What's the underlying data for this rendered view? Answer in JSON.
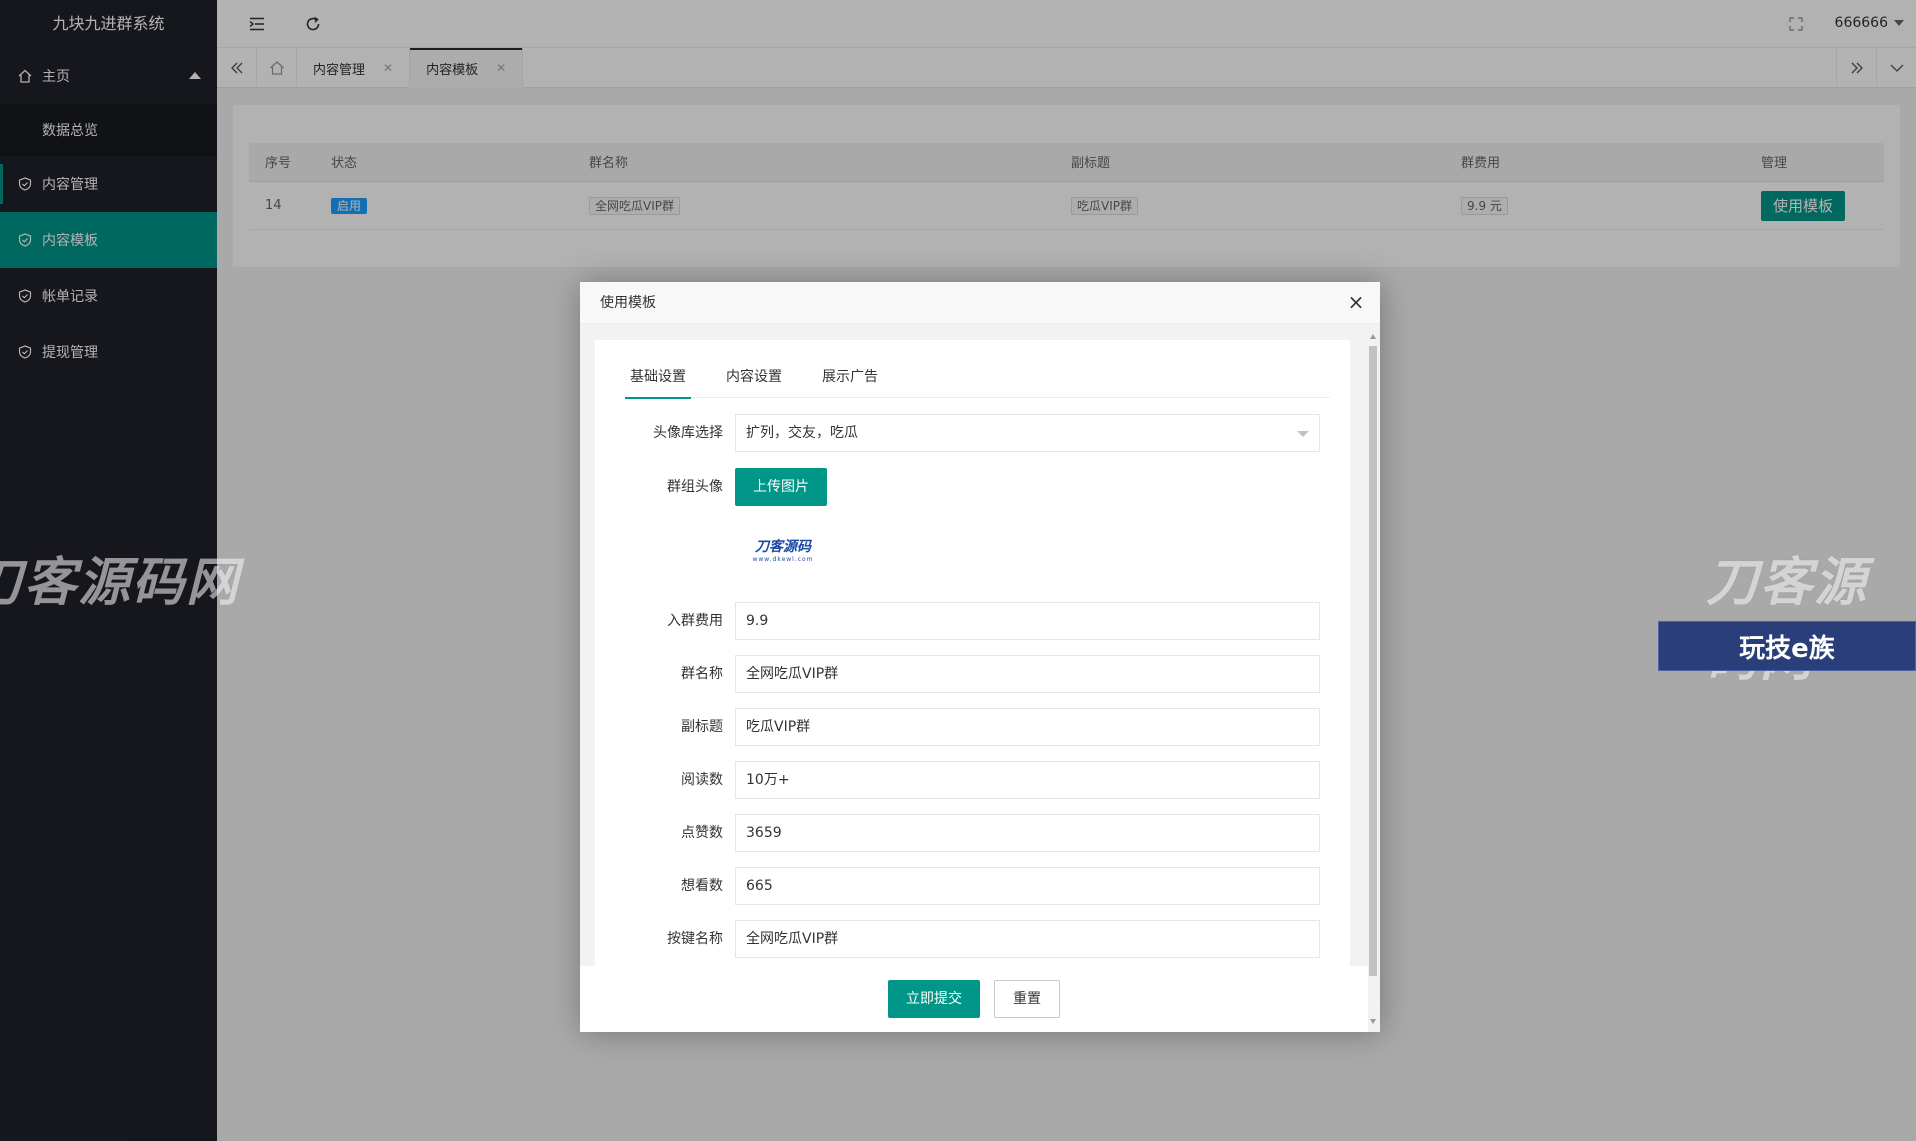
{
  "app": {
    "title": "九块九进群系统"
  },
  "sidebar": {
    "items": [
      {
        "label": "主页"
      },
      {
        "label": "数据总览"
      },
      {
        "label": "内容管理"
      },
      {
        "label": "内容模板"
      },
      {
        "label": "帐单记录"
      },
      {
        "label": "提现管理"
      }
    ]
  },
  "header": {
    "user": "666666"
  },
  "tabs": [
    {
      "label": "内容管理"
    },
    {
      "label": "内容模板"
    }
  ],
  "table": {
    "columns": [
      "序号",
      "状态",
      "群名称",
      "副标题",
      "群费用",
      "管理"
    ],
    "rows": [
      {
        "id": "14",
        "status": "启用",
        "name": "全网吃瓜VIP群",
        "subtitle": "吃瓜VIP群",
        "fee": "9.9 元",
        "action": "使用模板"
      }
    ]
  },
  "modal": {
    "title": "使用模板",
    "tabs": [
      "基础设置",
      "内容设置",
      "展示广告"
    ],
    "fields": {
      "avatar_lib_label": "头像库选择",
      "avatar_lib_value": "扩列，交友，吃瓜",
      "group_avatar_label": "群组头像",
      "upload_label": "上传图片",
      "fee_label": "入群费用",
      "fee_value": "9.9",
      "name_label": "群名称",
      "name_value": "全网吃瓜VIP群",
      "subtitle_label": "副标题",
      "subtitle_value": "吃瓜VIP群",
      "reads_label": "阅读数",
      "reads_value": "10万+",
      "likes_label": "点赞数",
      "likes_value": "3659",
      "wants_label": "想看数",
      "wants_value": "665",
      "button_label": "按键名称",
      "button_value": "全网吃瓜VIP群"
    },
    "thumb": {
      "line1": "刀客源码",
      "line2": "www.dkewl.com"
    },
    "submit": "立即提交",
    "reset": "重置"
  },
  "watermark": {
    "text": "刀客源码网"
  },
  "ad": {
    "text": "玩技e族"
  },
  "colors": {
    "accent": "#009688",
    "sidebar": "#20222a",
    "badge": "#1e9fff"
  }
}
